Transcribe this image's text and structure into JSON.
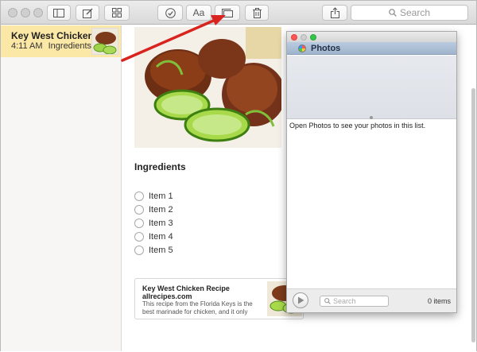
{
  "toolbar": {
    "search_placeholder": "Search",
    "format_label": "Aa"
  },
  "note": {
    "title": "Key West Chicken",
    "time": "4:11 AM",
    "preview": "Ingredients"
  },
  "editor": {
    "heading": "Ingredients",
    "items": [
      "Item 1",
      "Item 2",
      "Item 3",
      "Item 4",
      "Item 5"
    ],
    "link_card": {
      "title": "Key West Chicken Recipe",
      "domain": "allrecipes.com",
      "description": "This recipe from the Florida Keys is the best marinade for chicken, and it only"
    }
  },
  "photos_panel": {
    "tab_label": "Photos",
    "message": "Open Photos to see your photos in this list.",
    "search_placeholder": "Search",
    "count": "0 items"
  },
  "colors": {
    "note_highlight": "#fbe7a6",
    "annotation_arrow": "#d9231f"
  }
}
